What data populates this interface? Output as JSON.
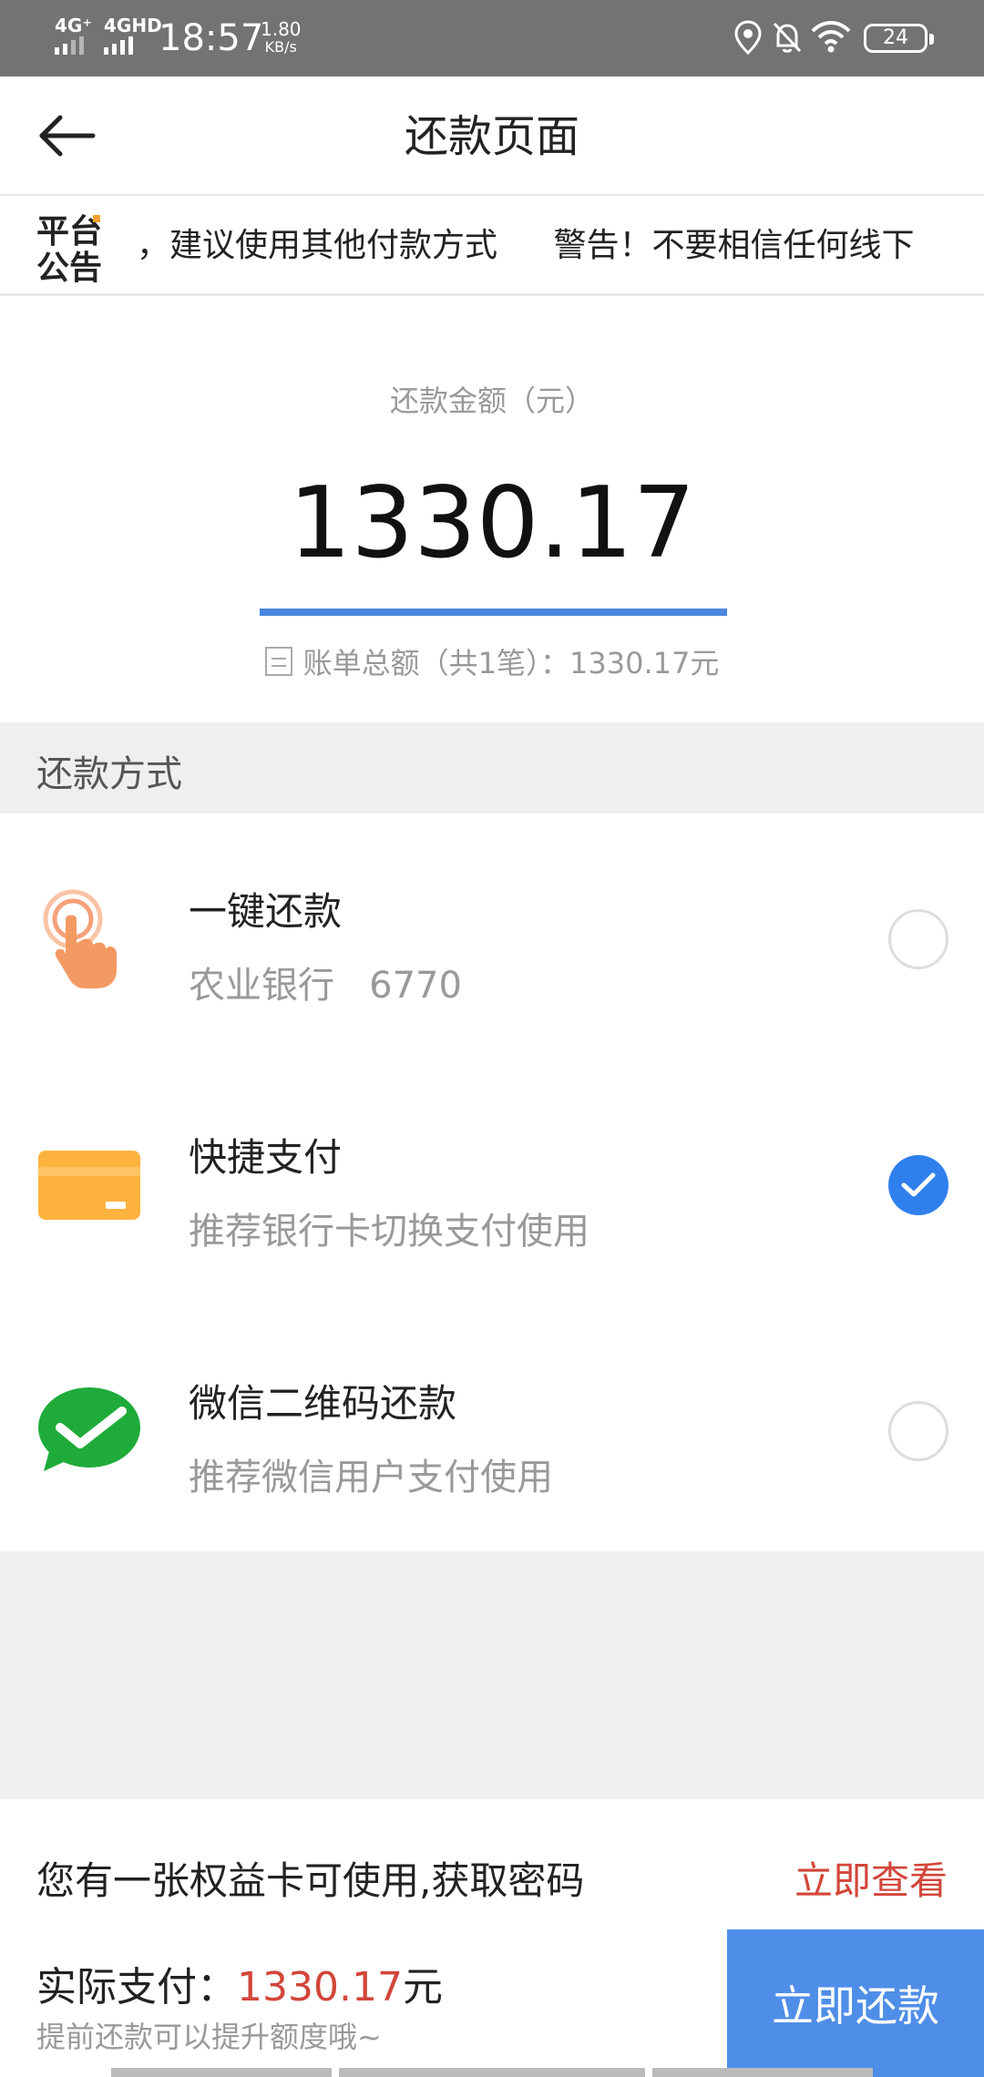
{
  "status_bar": {
    "net1": "4G⁺",
    "net2": "4GHD",
    "time": "18:57",
    "speed_value": "1.80",
    "speed_unit": "KB/s",
    "battery": "24",
    "icons": [
      "location-icon",
      "bell-off-icon",
      "wifi-icon",
      "battery-icon"
    ]
  },
  "header": {
    "title": "还款页面",
    "back_icon": "arrow-left-icon"
  },
  "notice": {
    "logo": "平台公告",
    "items": [
      "，建议使用其他付款方式",
      "警告！不要相信任何线下"
    ]
  },
  "amount": {
    "label": "还款金额（元）",
    "value": "1330.17",
    "bill_summary": "账单总额（共1笔）：1330.17元"
  },
  "pay_methods": {
    "title": "还款方式",
    "options": [
      {
        "title": "一键还款",
        "subtitle": "农业银行   6770",
        "icon": "tap-hand-icon",
        "selected": false
      },
      {
        "title": "快捷支付",
        "subtitle": "推荐银行卡切换支付使用",
        "icon": "bank-card-icon",
        "selected": true
      },
      {
        "title": "微信二维码还款",
        "subtitle": "推荐微信用户支付使用",
        "icon": "wechat-icon",
        "selected": false
      }
    ]
  },
  "bottom": {
    "card_text": "您有一张权益卡可使用,获取密码",
    "card_link": "立即查看",
    "actual_label": "实际支付：",
    "actual_value": "1330.17",
    "actual_unit": "元",
    "hint": "提前还款可以提升额度哦~",
    "pay_button": "立即还款"
  },
  "colors": {
    "accent": "#4f8ee8",
    "amount_line": "#4a86e0",
    "price_red": "#d2463a",
    "wechat_green": "#1fab3a",
    "card_orange": "#ffb33f"
  }
}
